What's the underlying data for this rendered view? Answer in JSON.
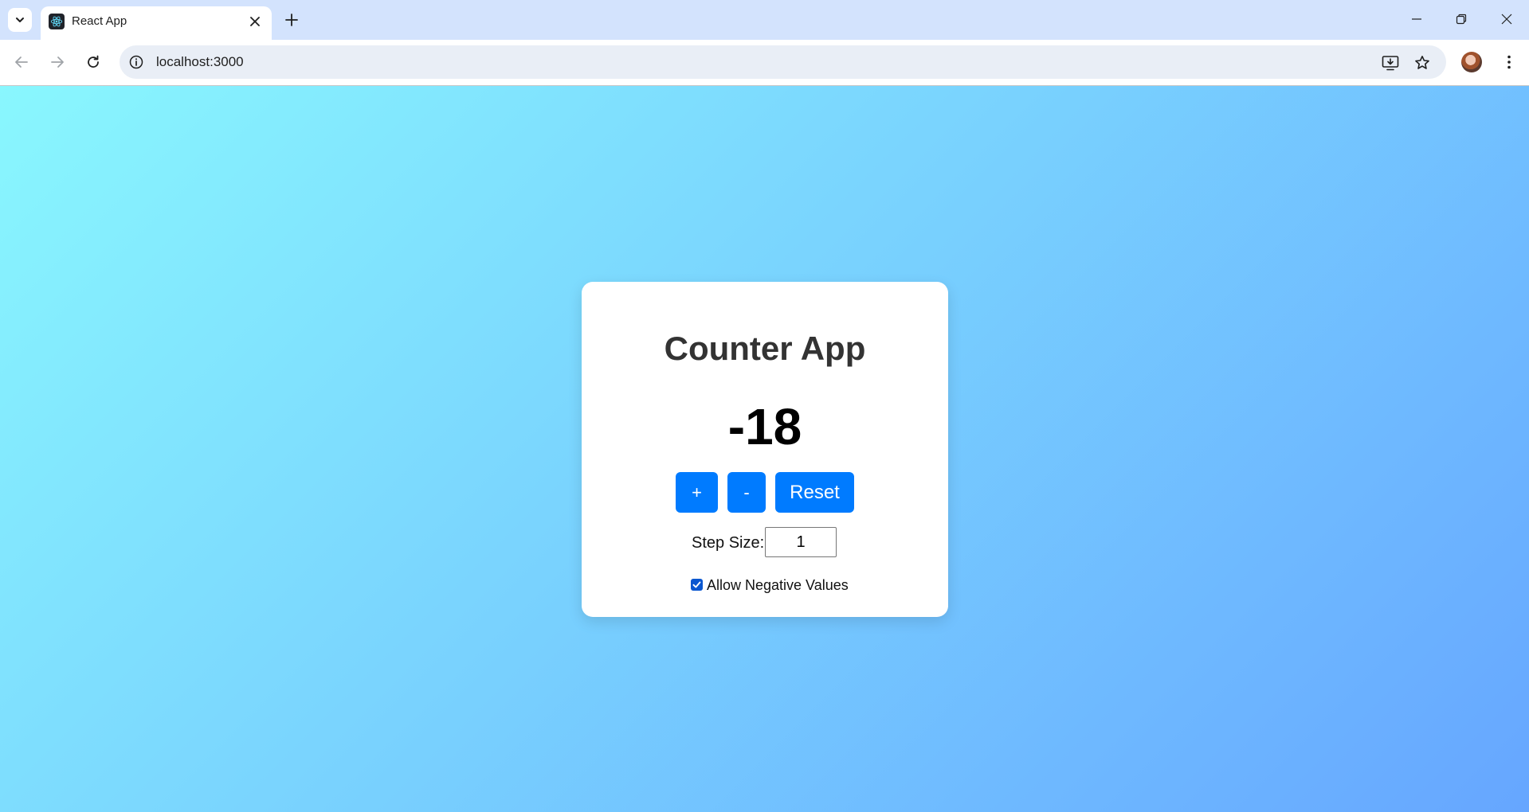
{
  "browser": {
    "tab": {
      "title": "React App",
      "favicon": "react-icon"
    },
    "address": {
      "url": "localhost:3000"
    }
  },
  "app": {
    "title": "Counter App",
    "count": "-18",
    "buttons": {
      "increment": "+",
      "decrement": "-",
      "reset": "Reset"
    },
    "step": {
      "label": "Step Size:",
      "value": "1"
    },
    "allow_negative": {
      "label": "Allow Negative Values",
      "checked": true
    }
  },
  "colors": {
    "accent": "#007bff",
    "gradient_start": "#89f7fe",
    "gradient_end": "#66a6ff",
    "tabstrip": "#d3e3fd"
  }
}
